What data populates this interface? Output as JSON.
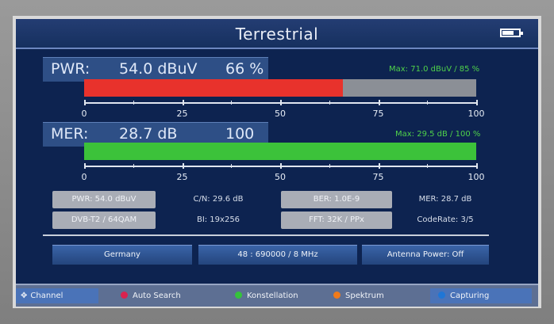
{
  "header": {
    "title": "Terrestrial"
  },
  "pwr": {
    "label": "PWR:",
    "value": "54.0 dBuV",
    "percent": "66 %",
    "max": "Max: 71.0 dBuV / 85 %",
    "level": 0.66
  },
  "mer": {
    "label": "MER:",
    "value": "28.7 dB",
    "percent": "100 %",
    "max": "Max: 29.5 dB / 100 %",
    "level": 1.0
  },
  "scale": {
    "labels": [
      "0",
      "25",
      "50",
      "75",
      "100"
    ]
  },
  "details": {
    "row1": [
      "PWR: 54.0 dBuV",
      "C/N: 29.6 dB",
      "BER: 1.0E-9",
      "MER: 28.7 dB"
    ],
    "row2": [
      "DVB-T2 / 64QAM",
      "BI: 19x256",
      "FFT: 32K / PPx",
      "CodeRate: 3/5"
    ]
  },
  "info": {
    "country": "Germany",
    "channel": "48 : 690000 / 8 MHz",
    "antenna": "Antenna Power: Off"
  },
  "footer": {
    "channel": "Channel",
    "auto_search": "Auto Search",
    "konstellation": "Konstellation",
    "spektrum": "Spektrum",
    "capturing": "Capturing"
  },
  "colors": {
    "pwr_bar": "#e8322c",
    "mer_bar": "#3cc23a",
    "max_text": "#4fd14a",
    "auto_search_dot": "#d9234f",
    "konstellation_dot": "#35c33b",
    "spektrum_dot": "#f07a19",
    "capturing_dot": "#1f76d6"
  },
  "icons": {
    "channel": "four-way-arrows-icon",
    "battery": "battery-icon"
  }
}
